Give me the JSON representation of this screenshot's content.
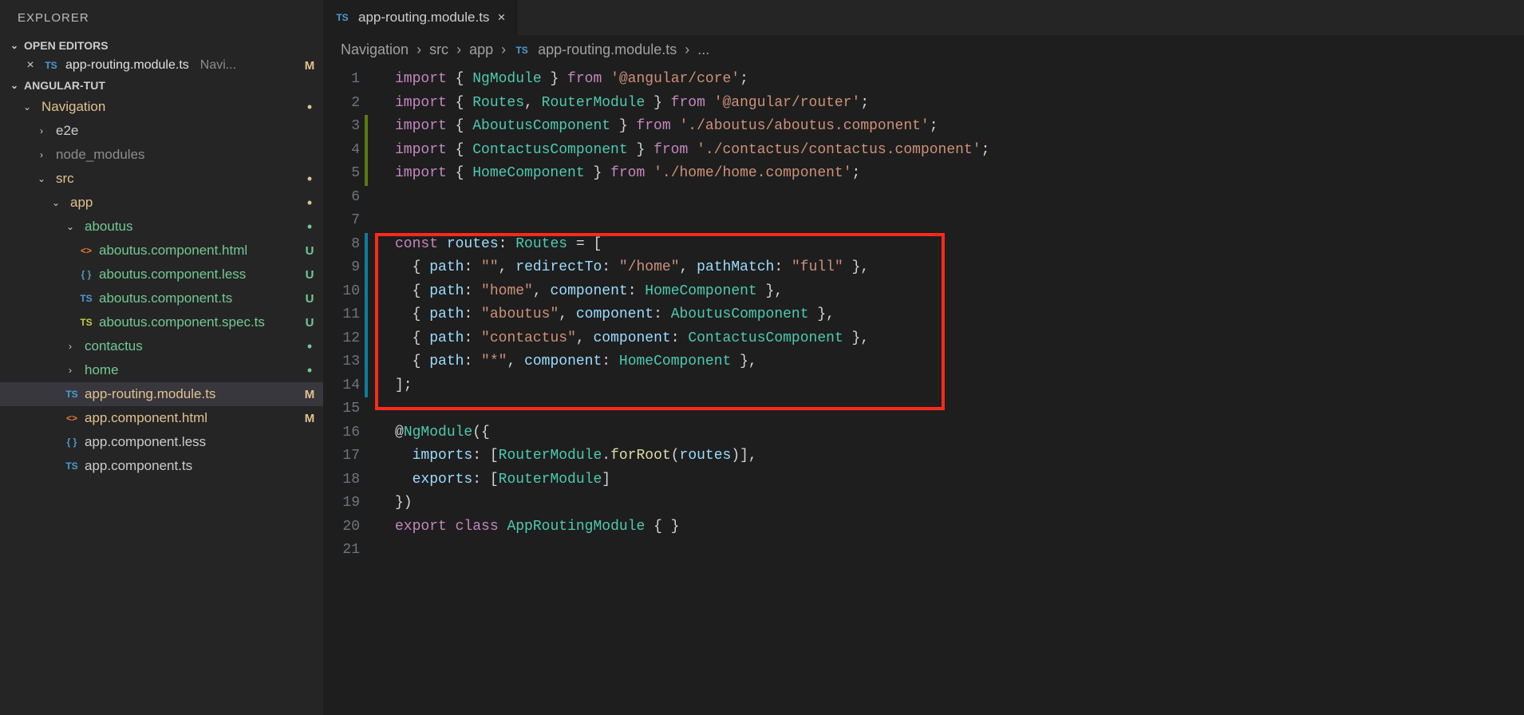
{
  "explorer": {
    "title": "EXPLORER"
  },
  "openEditors": {
    "title": "OPEN EDITORS",
    "file": {
      "icon": "TS",
      "name": "app-routing.module.ts",
      "path": "Navi...",
      "status": "M"
    }
  },
  "project": {
    "name": "ANGULAR-TUT",
    "tree": {
      "navigation": "Navigation",
      "e2e": "e2e",
      "node_modules": "node_modules",
      "src": "src",
      "app": "app",
      "aboutus": "aboutus",
      "files": {
        "aboutus_html": {
          "icon": "<>",
          "name": "aboutus.component.html",
          "status": "U"
        },
        "aboutus_less": {
          "icon": "{ }",
          "name": "aboutus.component.less",
          "status": "U"
        },
        "aboutus_ts": {
          "icon": "TS",
          "name": "aboutus.component.ts",
          "status": "U"
        },
        "aboutus_spec": {
          "icon": "TS",
          "name": "aboutus.component.spec.ts",
          "status": "U"
        },
        "contactus": "contactus",
        "home": "home",
        "routing": {
          "icon": "TS",
          "name": "app-routing.module.ts",
          "status": "M"
        },
        "app_html": {
          "icon": "<>",
          "name": "app.component.html",
          "status": "M"
        },
        "app_less": {
          "icon": "{ }",
          "name": "app.component.less"
        },
        "app_ts": {
          "icon": "TS",
          "name": "app.component.ts"
        }
      }
    }
  },
  "tab": {
    "icon": "TS",
    "name": "app-routing.module.ts"
  },
  "breadcrumbs": {
    "seg1": "Navigation",
    "seg2": "src",
    "seg3": "app",
    "seg4_icon": "TS",
    "seg4": "app-routing.module.ts",
    "seg5": "..."
  },
  "code": {
    "lines": [
      {
        "n": 1,
        "tokens": [
          [
            "kw",
            "import"
          ],
          [
            "plain",
            " { "
          ],
          [
            "type",
            "NgModule"
          ],
          [
            "plain",
            " } "
          ],
          [
            "kw",
            "from"
          ],
          [
            "plain",
            " "
          ],
          [
            "str",
            "'@angular/core'"
          ],
          [
            "plain",
            ";"
          ]
        ]
      },
      {
        "n": 2,
        "tokens": [
          [
            "kw",
            "import"
          ],
          [
            "plain",
            " { "
          ],
          [
            "type",
            "Routes"
          ],
          [
            "plain",
            ", "
          ],
          [
            "type",
            "RouterModule"
          ],
          [
            "plain",
            " } "
          ],
          [
            "kw",
            "from"
          ],
          [
            "plain",
            " "
          ],
          [
            "str",
            "'@angular/router'"
          ],
          [
            "plain",
            ";"
          ]
        ]
      },
      {
        "n": 3,
        "flag": "changed",
        "tokens": [
          [
            "kw",
            "import"
          ],
          [
            "plain",
            " { "
          ],
          [
            "type",
            "AboutusComponent"
          ],
          [
            "plain",
            " } "
          ],
          [
            "kw",
            "from"
          ],
          [
            "plain",
            " "
          ],
          [
            "str",
            "'./aboutus/aboutus.component'"
          ],
          [
            "plain",
            ";"
          ]
        ]
      },
      {
        "n": 4,
        "flag": "changed",
        "tokens": [
          [
            "kw",
            "import"
          ],
          [
            "plain",
            " { "
          ],
          [
            "type",
            "ContactusComponent"
          ],
          [
            "plain",
            " } "
          ],
          [
            "kw",
            "from"
          ],
          [
            "plain",
            " "
          ],
          [
            "str",
            "'./contactus/contactus.component'"
          ],
          [
            "plain",
            ";"
          ]
        ]
      },
      {
        "n": 5,
        "flag": "changed",
        "tokens": [
          [
            "kw",
            "import"
          ],
          [
            "plain",
            " { "
          ],
          [
            "type",
            "HomeComponent"
          ],
          [
            "plain",
            " } "
          ],
          [
            "kw",
            "from"
          ],
          [
            "plain",
            " "
          ],
          [
            "str",
            "'./home/home.component'"
          ],
          [
            "plain",
            ";"
          ]
        ]
      },
      {
        "n": 6,
        "tokens": []
      },
      {
        "n": 7,
        "tokens": []
      },
      {
        "n": 8,
        "flag": "addblue",
        "tokens": [
          [
            "kw",
            "const"
          ],
          [
            "plain",
            " "
          ],
          [
            "id",
            "routes"
          ],
          [
            "plain",
            ": "
          ],
          [
            "type",
            "Routes"
          ],
          [
            "plain",
            " = ["
          ]
        ]
      },
      {
        "n": 9,
        "flag": "addblue",
        "tokens": [
          [
            "plain",
            "  { "
          ],
          [
            "prop",
            "path"
          ],
          [
            "plain",
            ": "
          ],
          [
            "str",
            "\"\""
          ],
          [
            "plain",
            ", "
          ],
          [
            "prop",
            "redirectTo"
          ],
          [
            "plain",
            ": "
          ],
          [
            "str",
            "\"/home\""
          ],
          [
            "plain",
            ", "
          ],
          [
            "prop",
            "pathMatch"
          ],
          [
            "plain",
            ": "
          ],
          [
            "str",
            "\"full\""
          ],
          [
            "plain",
            " },"
          ]
        ]
      },
      {
        "n": 10,
        "flag": "addblue",
        "tokens": [
          [
            "plain",
            "  { "
          ],
          [
            "prop",
            "path"
          ],
          [
            "plain",
            ": "
          ],
          [
            "str",
            "\"home\""
          ],
          [
            "plain",
            ", "
          ],
          [
            "prop",
            "component"
          ],
          [
            "plain",
            ": "
          ],
          [
            "type",
            "HomeComponent"
          ],
          [
            "plain",
            " },"
          ]
        ]
      },
      {
        "n": 11,
        "flag": "addblue",
        "tokens": [
          [
            "plain",
            "  { "
          ],
          [
            "prop",
            "path"
          ],
          [
            "plain",
            ": "
          ],
          [
            "str",
            "\"aboutus\""
          ],
          [
            "plain",
            ", "
          ],
          [
            "prop",
            "component"
          ],
          [
            "plain",
            ": "
          ],
          [
            "type",
            "AboutusComponent"
          ],
          [
            "plain",
            " },"
          ]
        ]
      },
      {
        "n": 12,
        "flag": "addblue",
        "tokens": [
          [
            "plain",
            "  { "
          ],
          [
            "prop",
            "path"
          ],
          [
            "plain",
            ": "
          ],
          [
            "str",
            "\"contactus\""
          ],
          [
            "plain",
            ", "
          ],
          [
            "prop",
            "component"
          ],
          [
            "plain",
            ": "
          ],
          [
            "type",
            "ContactusComponent"
          ],
          [
            "plain",
            " },"
          ]
        ]
      },
      {
        "n": 13,
        "flag": "addblue",
        "tokens": [
          [
            "plain",
            "  { "
          ],
          [
            "prop",
            "path"
          ],
          [
            "plain",
            ": "
          ],
          [
            "str",
            "\"*\""
          ],
          [
            "plain",
            ", "
          ],
          [
            "prop",
            "component"
          ],
          [
            "plain",
            ": "
          ],
          [
            "type",
            "HomeComponent"
          ],
          [
            "plain",
            " },"
          ]
        ]
      },
      {
        "n": 14,
        "flag": "addblue",
        "tokens": [
          [
            "plain",
            "];"
          ]
        ]
      },
      {
        "n": 15,
        "tokens": []
      },
      {
        "n": 16,
        "tokens": [
          [
            "plain",
            "@"
          ],
          [
            "dec",
            "NgModule"
          ],
          [
            "plain",
            "({"
          ]
        ]
      },
      {
        "n": 17,
        "tokens": [
          [
            "plain",
            "  "
          ],
          [
            "prop",
            "imports"
          ],
          [
            "plain",
            ": ["
          ],
          [
            "type",
            "RouterModule"
          ],
          [
            "plain",
            "."
          ],
          [
            "fn",
            "forRoot"
          ],
          [
            "plain",
            "("
          ],
          [
            "id",
            "routes"
          ],
          [
            "plain",
            ")],"
          ]
        ]
      },
      {
        "n": 18,
        "tokens": [
          [
            "plain",
            "  "
          ],
          [
            "prop",
            "exports"
          ],
          [
            "plain",
            ": ["
          ],
          [
            "type",
            "RouterModule"
          ],
          [
            "plain",
            "]"
          ]
        ]
      },
      {
        "n": 19,
        "tokens": [
          [
            "plain",
            "})"
          ]
        ]
      },
      {
        "n": 20,
        "tokens": [
          [
            "kw",
            "export"
          ],
          [
            "plain",
            " "
          ],
          [
            "kw",
            "class"
          ],
          [
            "plain",
            " "
          ],
          [
            "cls",
            "AppRoutingModule"
          ],
          [
            "plain",
            " { }"
          ]
        ]
      },
      {
        "n": 21,
        "tokens": []
      }
    ]
  }
}
